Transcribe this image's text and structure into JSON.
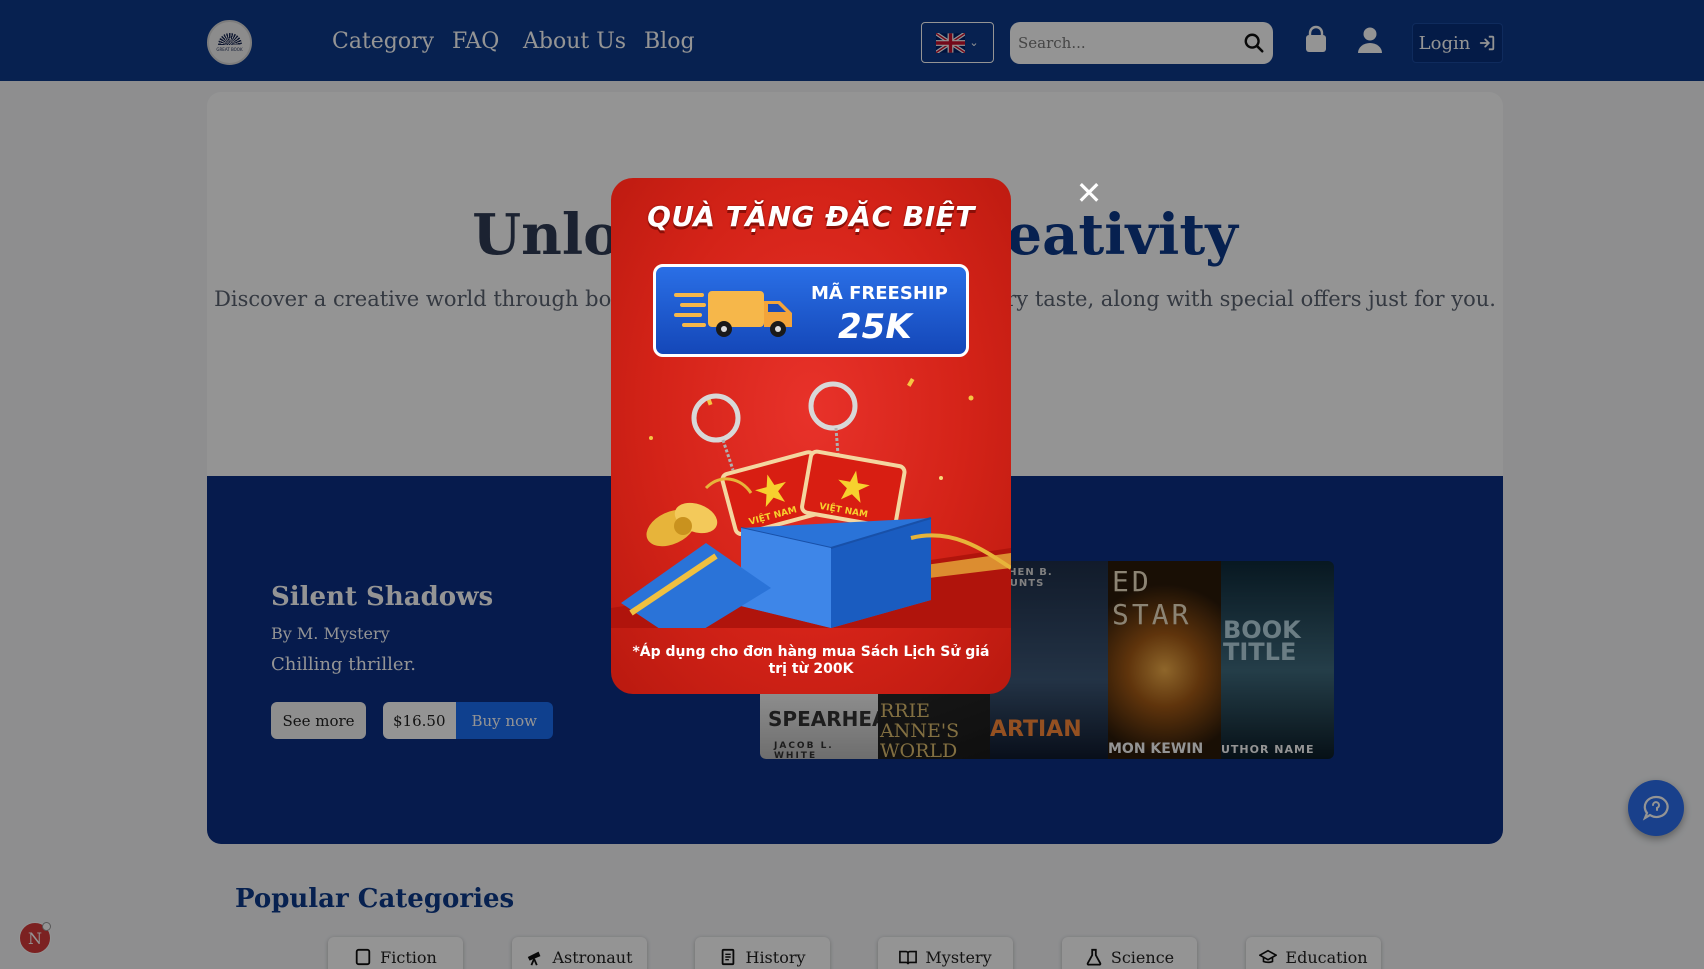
{
  "header": {
    "logo_text": "GREAT BOOK",
    "nav": [
      "Category",
      "FAQ",
      "About Us",
      "Blog"
    ],
    "search_placeholder": "Search...",
    "login_label": "Login"
  },
  "hero": {
    "title_left": "Unlo",
    "title_right": "eativity",
    "subtitle_left": "Discover a creative world through bo",
    "subtitle_right": "ry taste, along with special offers just for you."
  },
  "featured": {
    "title": "Silent Shadows",
    "author": "By M. Mystery",
    "description": "Chilling thriller.",
    "see_more": "See more",
    "price": "$16.50",
    "buy_now": "Buy now",
    "covers": [
      {
        "title": "SPEARHEAD",
        "author": "JACOB L. WHITE"
      },
      {
        "title": "RRIE ANNE'S WORLD",
        "author": ""
      },
      {
        "title": "ARTIAN",
        "author": "EPHEN B. HAUNTS"
      },
      {
        "title": "ED STAR",
        "author": "MON KEWIN"
      },
      {
        "title": "BOOK TITLE",
        "author": "UTHOR NAME"
      }
    ]
  },
  "categories": {
    "title": "Popular Categories",
    "items": [
      "Fiction",
      "Astronaut",
      "History",
      "Mystery",
      "Science",
      "Education"
    ]
  },
  "notification_badge": "N",
  "popup": {
    "title": "QUÀ TẶNG ĐẶC BIỆT",
    "voucher_line1": "MÃ FREESHIP",
    "voucher_line2": "25K",
    "keychain_text": "VIỆT NAM",
    "note": "*Áp dụng cho đơn hàng mua Sách Lịch Sử giá trị từ 200K"
  },
  "colors": {
    "brand_blue": "#0d3a8a",
    "popup_red": "#d42318",
    "buy_blue": "#1a6ef5"
  }
}
